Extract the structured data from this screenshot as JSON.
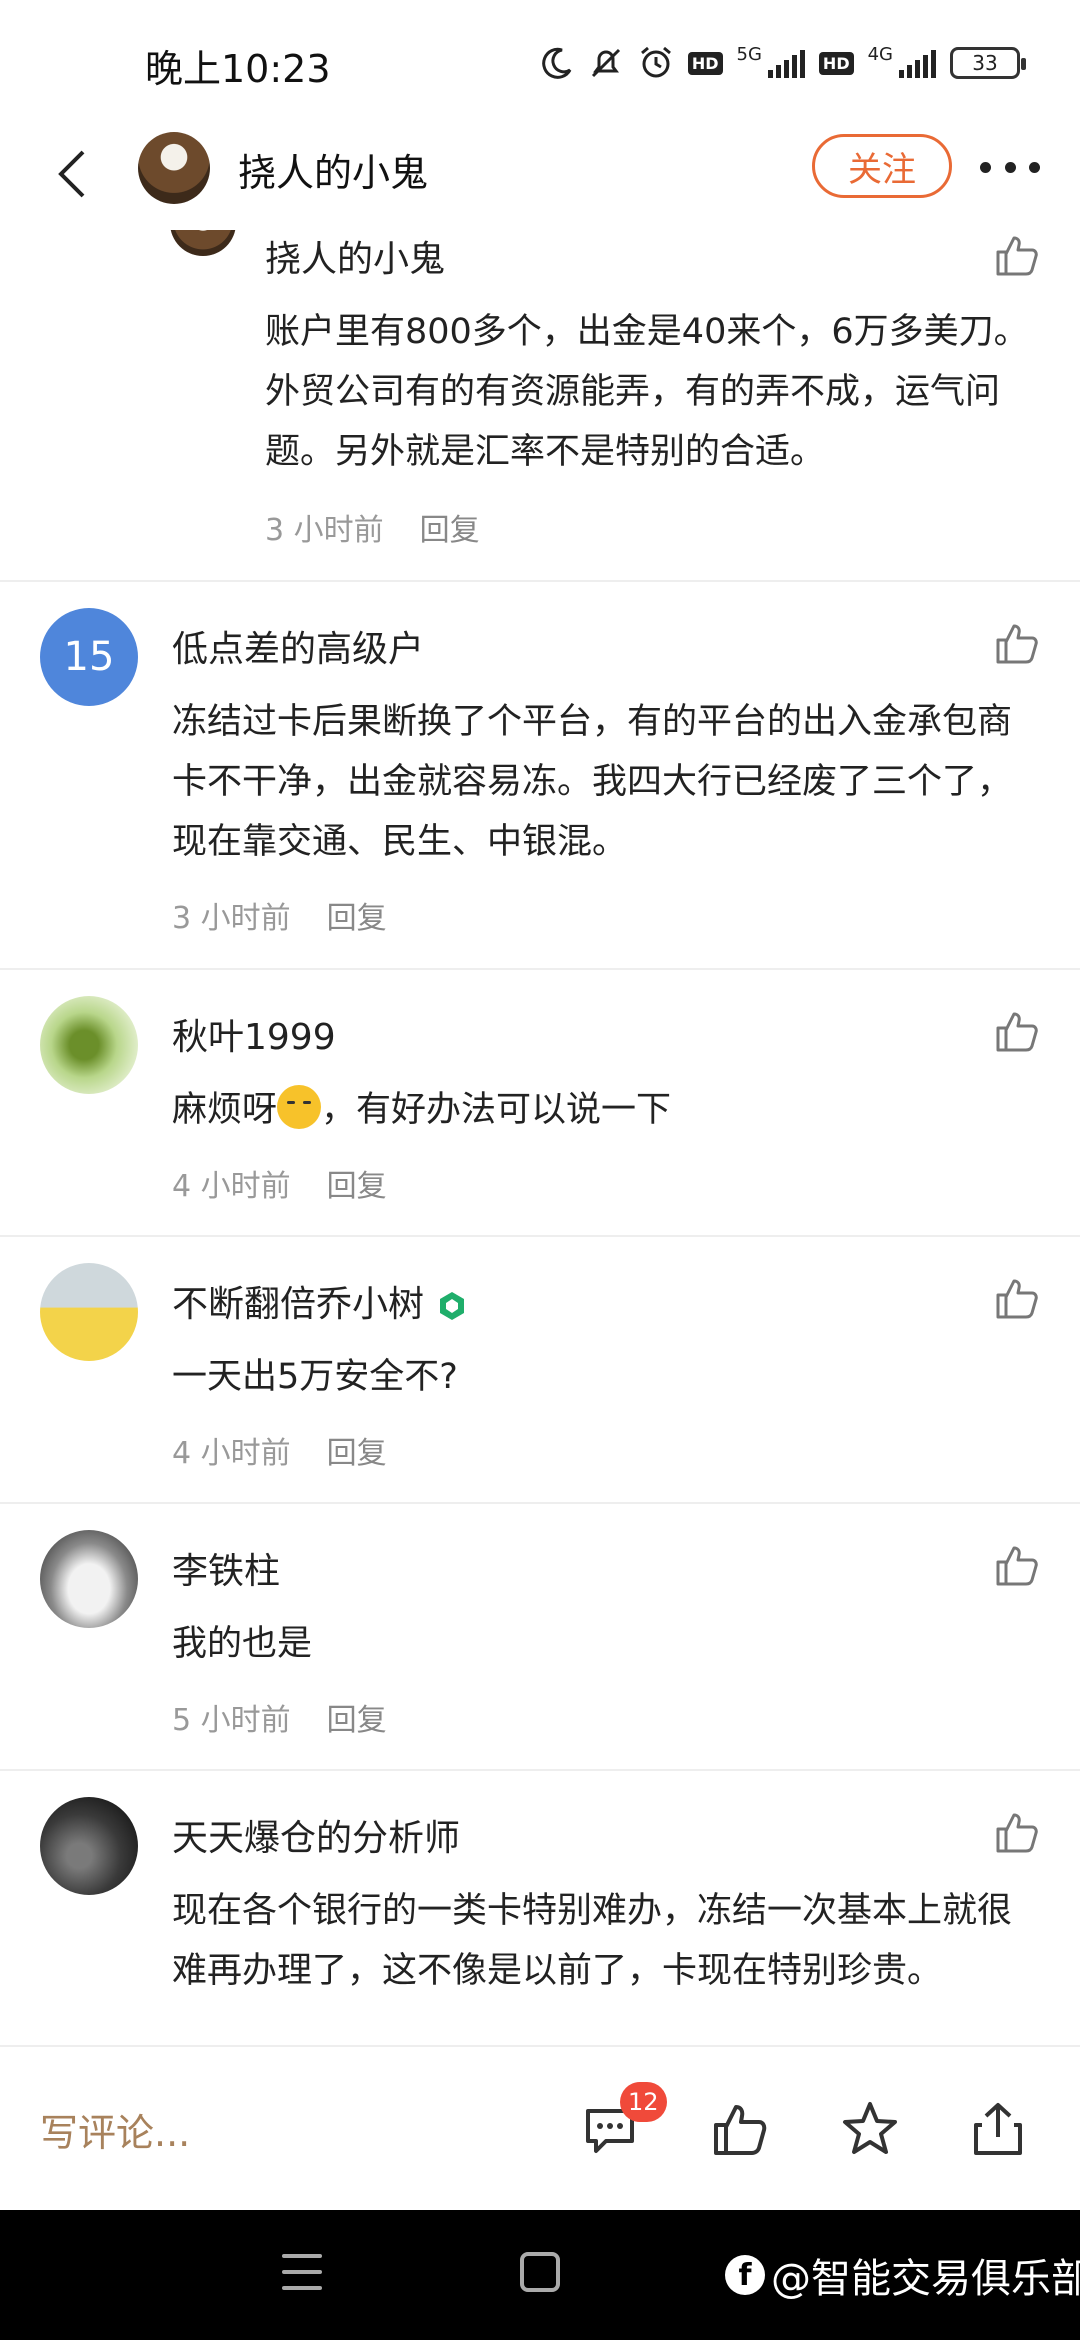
{
  "status_bar": {
    "time": "晚上10:23",
    "network_1": "5G",
    "network_2": "4G",
    "hd_label": "HD",
    "battery": "33"
  },
  "header": {
    "username": "挠人的小鬼",
    "follow_label": "关注"
  },
  "comments": [
    {
      "username": "挠人的小鬼",
      "text": "账户里有800多个，出金是40来个，6万多美刀。外贸公司有的有资源能弄，有的弄不成，运气问题。另外就是汇率不是特别的合适。",
      "time": "3 小时前",
      "reply": "回复"
    },
    {
      "username": "低点差的高级户",
      "avatar_text": "15",
      "text": "冻结过卡后果断换了个平台，有的平台的出入金承包商卡不干净，出金就容易冻。我四大行已经废了三个了，现在靠交通、民生、中银混。",
      "time": "3 小时前",
      "reply": "回复"
    },
    {
      "username": "秋叶1999",
      "text_before": "麻烦呀",
      "text_after": "，有好办法可以说一下",
      "time": "4 小时前",
      "reply": "回复"
    },
    {
      "username": "不断翻倍乔小树",
      "text": "一天出5万安全不?",
      "time": "4 小时前",
      "reply": "回复"
    },
    {
      "username": "李铁柱",
      "text": "我的也是",
      "time": "5 小时前",
      "reply": "回复"
    },
    {
      "username": "天天爆仓的分析师",
      "text": "现在各个银行的一类卡特别难办，冻结一次基本上就很难再办理了，这不像是以前了，卡现在特别珍贵。"
    }
  ],
  "bottom_bar": {
    "write_placeholder": "写评论...",
    "comment_count": "12"
  },
  "watermark": "@智能交易俱乐部",
  "colors": {
    "accent": "#e96a35",
    "badge": "#f04a3a",
    "avatar_blue": "#4f86db",
    "write_text": "#a8825c"
  }
}
